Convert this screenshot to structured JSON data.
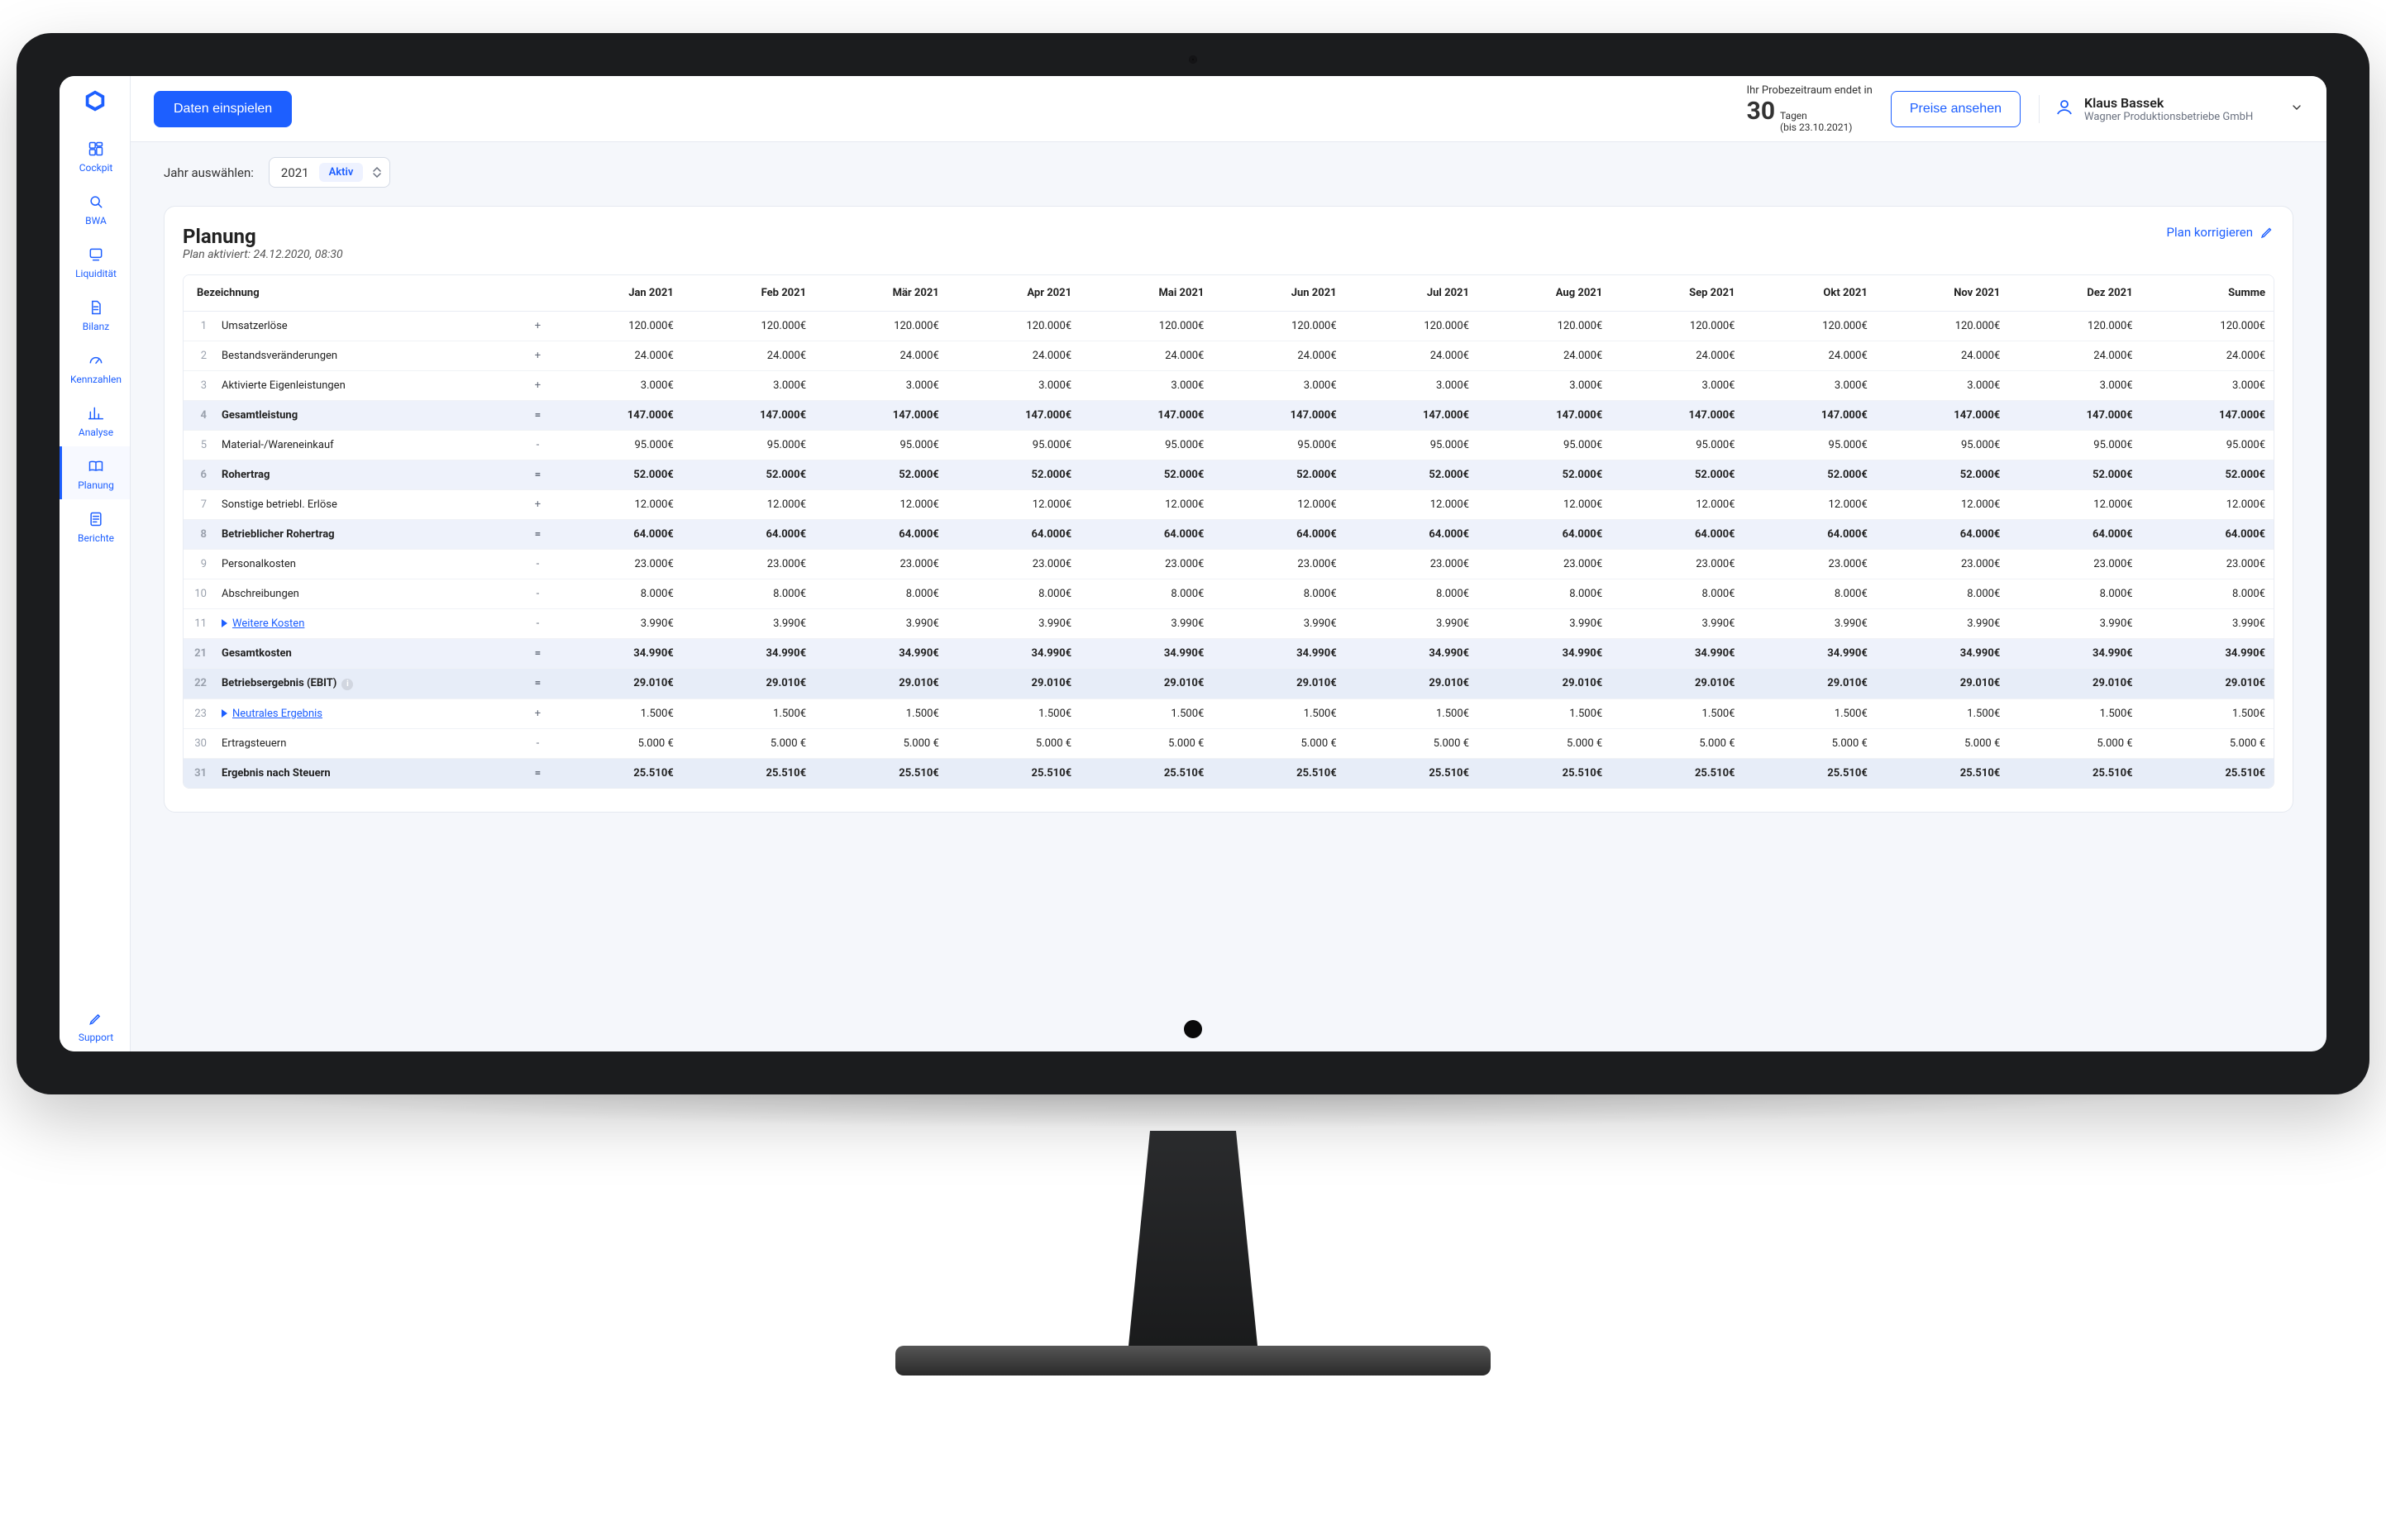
{
  "sidebar": {
    "items": [
      {
        "label": "Cockpit"
      },
      {
        "label": "BWA"
      },
      {
        "label": "Liquidität"
      },
      {
        "label": "Bilanz"
      },
      {
        "label": "Kennzahlen"
      },
      {
        "label": "Analyse"
      },
      {
        "label": "Planung"
      },
      {
        "label": "Berichte"
      },
      {
        "label": "Support"
      }
    ]
  },
  "topbar": {
    "primaryButton": "Daten einspielen",
    "trial": {
      "prefix": "Ihr Probezeitraum endet in",
      "days": "30",
      "unit": "Tagen",
      "until": "(bis 23.10.2021)"
    },
    "pricingButton": "Preise ansehen",
    "user": {
      "name": "Klaus Bassek",
      "company": "Wagner Produktionsbetriebe GmbH"
    }
  },
  "yearbar": {
    "label": "Jahr auswählen:",
    "year": "2021",
    "status": "Aktiv"
  },
  "panel": {
    "title": "Planung",
    "subtitle": "Plan aktiviert: 24.12.2020, 08:30",
    "editLabel": "Plan korrigieren"
  },
  "table": {
    "headers": [
      "Bezeichnung",
      "Jan 2021",
      "Feb 2021",
      "Mär 2021",
      "Apr 2021",
      "Mai 2021",
      "Jun 2021",
      "Jul 2021",
      "Aug 2021",
      "Sep 2021",
      "Okt 2021",
      "Nov 2021",
      "Dez 2021",
      "Summe"
    ],
    "rows": [
      {
        "n": 1,
        "name": "Umsatzerlöse",
        "op": "+",
        "v": "120.000€",
        "sum": false
      },
      {
        "n": 2,
        "name": "Bestandsveränderungen",
        "op": "+",
        "v": "24.000€",
        "sum": false
      },
      {
        "n": 3,
        "name": "Aktivierte Eigenleistungen",
        "op": "+",
        "v": "3.000€",
        "sum": false
      },
      {
        "n": 4,
        "name": "Gesamtleistung",
        "op": "=",
        "v": "147.000€",
        "sum": true
      },
      {
        "n": 5,
        "name": "Material-/Wareneinkauf",
        "op": "-",
        "v": "95.000€",
        "sum": false
      },
      {
        "n": 6,
        "name": "Rohertrag",
        "op": "=",
        "v": "52.000€",
        "sum": true
      },
      {
        "n": 7,
        "name": "Sonstige betriebl. Erlöse",
        "op": "+",
        "v": "12.000€",
        "sum": false
      },
      {
        "n": 8,
        "name": "Betrieblicher Rohertrag",
        "op": "=",
        "v": "64.000€",
        "sum": true
      },
      {
        "n": 9,
        "name": "Personalkosten",
        "op": "-",
        "v": "23.000€",
        "sum": false
      },
      {
        "n": 10,
        "name": "Abschreibungen",
        "op": "-",
        "v": "8.000€",
        "sum": false
      },
      {
        "n": 11,
        "name": "Weitere Kosten",
        "op": "-",
        "v": "3.990€",
        "sum": false,
        "link": true,
        "arrow": true
      },
      {
        "n": 21,
        "name": "Gesamtkosten",
        "op": "=",
        "v": "34.990€",
        "sum": true
      },
      {
        "n": 22,
        "name": "Betriebsergebnis (EBIT)",
        "op": "=",
        "v": "29.010€",
        "sum": true,
        "info": true,
        "dark": true
      },
      {
        "n": 23,
        "name": "Neutrales Ergebnis",
        "op": "+",
        "v": "1.500€",
        "sum": false,
        "link": true,
        "arrow": true
      },
      {
        "n": 30,
        "name": "Ertragsteuern",
        "op": "-",
        "v": "5.000 €",
        "sum": false
      },
      {
        "n": 31,
        "name": "Ergebnis nach Steuern",
        "op": "=",
        "v": "25.510€",
        "sum": true,
        "dark": true
      }
    ]
  }
}
